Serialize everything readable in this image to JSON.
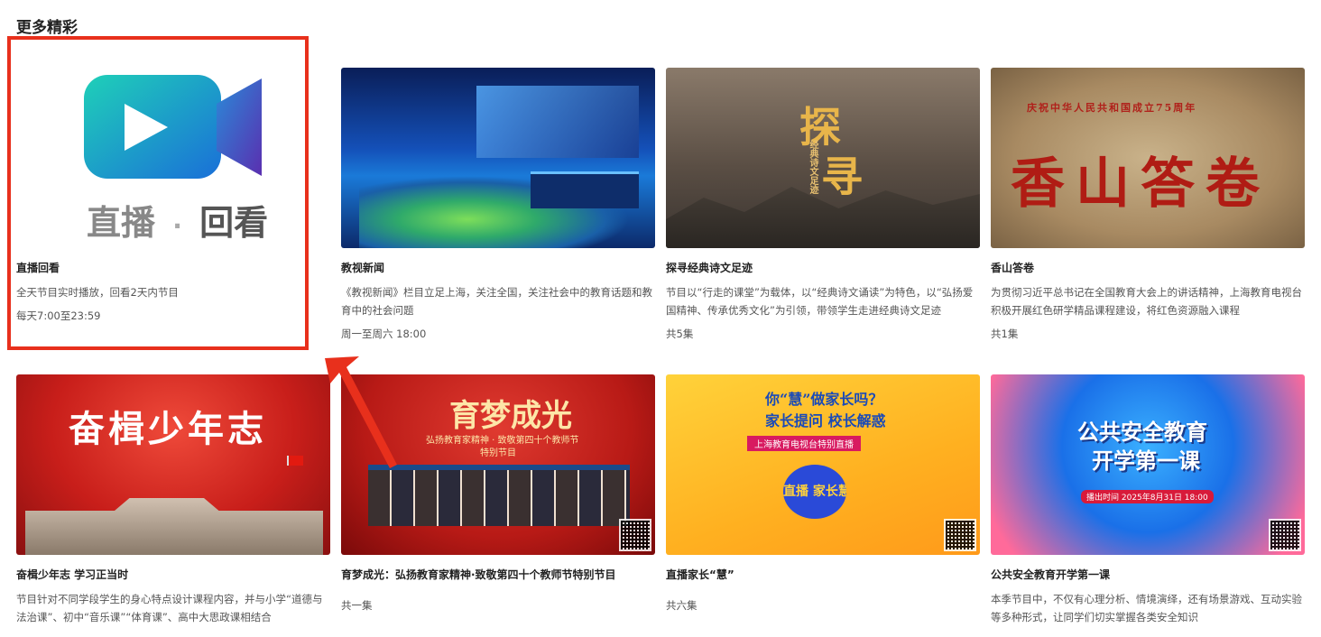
{
  "section": {
    "title": "更多精彩"
  },
  "colors": {
    "accent_red": "#e8301c"
  },
  "cards": [
    {
      "title": "直播回看",
      "desc": "全天节目实时播放，回看2天内节目",
      "meta": "每天7:00至23:59",
      "thumb": {
        "logo_text_a": "直播",
        "logo_dot": "·",
        "logo_text_b": "回看",
        "icon": "video-play-icon"
      }
    },
    {
      "title": "教视新闻",
      "desc": "《教视新闻》栏目立足上海，关注全国，关注社会中的教育话题和教育中的社会问题",
      "meta": "周一至周六 18:00"
    },
    {
      "title": "探寻经典诗文足迹",
      "desc": "节目以“行走的课堂”为载体，以“经典诗文诵读”为特色，以“弘扬爱国精神、传承优秀文化”为引领，带领学生走进经典诗文足迹",
      "meta": "共5集",
      "thumb": {
        "big": "探",
        "big2": "寻",
        "sub": "经典诗文足迹"
      }
    },
    {
      "title": "香山答卷",
      "desc": "为贯彻习近平总书记在全国教育大会上的讲话精神，上海教育电视台积极开展红色研学精品课程建设，将红色资源融入课程",
      "meta": "共1集",
      "thumb": {
        "top": "庆祝中华人民共和国成立75周年",
        "big": "香山答卷"
      }
    },
    {
      "title": "奋楫少年志 学习正当时",
      "desc": "节目针对不同学段学生的身心特点设计课程内容，并与小学“道德与法治课”、初中“音乐课”“体育课”、高中大思政课相结合",
      "meta": "",
      "thumb": {
        "big": "奋楫少年志"
      }
    },
    {
      "title": "育梦成光：弘扬教育家精神·致敬第四十个教师节特别节目",
      "desc": "",
      "meta": "共一集",
      "thumb": {
        "big": "育梦成光",
        "sub": "弘扬教育家精神 · 致敬第四十个教师节",
        "sub2": "特别节目"
      }
    },
    {
      "title": "直播家长“慧”",
      "desc": "",
      "meta": "共六集",
      "thumb": {
        "head": "你“慧”做家长吗？",
        "head2": "家长提问 校长解惑",
        "band": "上海教育电视台特别直播",
        "badge": "直播 家长慧"
      }
    },
    {
      "title": "公共安全教育开学第一课",
      "desc": "本季节目中，不仅有心理分析、情境演绎，还有场景游戏、互动实验等多种形式，让同学们切实掌握各类安全知识",
      "meta": "",
      "thumb": {
        "big": "公共安全教育",
        "big2": "开学第一课",
        "date": "播出时间 2025年8月31日 18:00"
      }
    }
  ]
}
